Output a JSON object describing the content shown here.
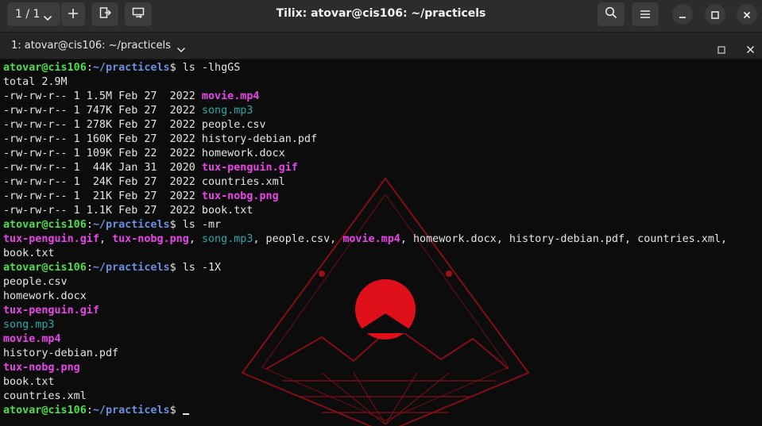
{
  "window": {
    "title": "Tilix: atovar@cis106: ~/practicels",
    "session_counter": "1 / 1"
  },
  "terminal_tab": {
    "label": "1: atovar@cis106: ~/practicels"
  },
  "colors": {
    "prompt_user": "#4edc4b",
    "prompt_path": "#6a8fe0",
    "media_file": "#e845e8",
    "audio_file": "#2aa9a9",
    "art_red": "#e0101a"
  },
  "icons": {
    "session_chevron": "chevron-down-icon",
    "add": "plus-icon",
    "new_terminal": "new-terminal-icon",
    "sync_input": "sync-input-icon",
    "search": "search-icon",
    "menu": "hamburger-menu-icon",
    "minimize": "minimize-icon",
    "maximize": "maximize-icon",
    "close": "close-icon"
  },
  "prompt": {
    "user": "atovar@cis106",
    "sep": ":",
    "path": "~/practicels",
    "dollar": "$"
  },
  "terminal_lines": [
    {
      "type": "prompt",
      "command": "ls -lhgGS"
    },
    {
      "type": "output",
      "segments": [
        {
          "text": "total 2.9M",
          "kind": "plain"
        }
      ]
    },
    {
      "type": "output",
      "segments": [
        {
          "text": "-rw-rw-r-- 1 1.5M Feb 27  2022 ",
          "kind": "plain"
        },
        {
          "text": "movie.mp4",
          "kind": "media"
        }
      ]
    },
    {
      "type": "output",
      "segments": [
        {
          "text": "-rw-rw-r-- 1 747K Feb 27  2022 ",
          "kind": "plain"
        },
        {
          "text": "song.mp3",
          "kind": "audio"
        }
      ]
    },
    {
      "type": "output",
      "segments": [
        {
          "text": "-rw-rw-r-- 1 278K Feb 27  2022 people.csv",
          "kind": "plain"
        }
      ]
    },
    {
      "type": "output",
      "segments": [
        {
          "text": "-rw-rw-r-- 1 160K Feb 27  2022 history-debian.pdf",
          "kind": "plain"
        }
      ]
    },
    {
      "type": "output",
      "segments": [
        {
          "text": "-rw-rw-r-- 1 109K Feb 22  2022 homework.docx",
          "kind": "plain"
        }
      ]
    },
    {
      "type": "output",
      "segments": [
        {
          "text": "-rw-rw-r-- 1  44K Jan 31  2020 ",
          "kind": "plain"
        },
        {
          "text": "tux-penguin.gif",
          "kind": "media"
        }
      ]
    },
    {
      "type": "output",
      "segments": [
        {
          "text": "-rw-rw-r-- 1  24K Feb 27  2022 countries.xml",
          "kind": "plain"
        }
      ]
    },
    {
      "type": "output",
      "segments": [
        {
          "text": "-rw-rw-r-- 1  21K Feb 27  2022 ",
          "kind": "plain"
        },
        {
          "text": "tux-nobg.png",
          "kind": "media"
        }
      ]
    },
    {
      "type": "output",
      "segments": [
        {
          "text": "-rw-rw-r-- 1 1.1K Feb 27  2022 book.txt",
          "kind": "plain"
        }
      ]
    },
    {
      "type": "prompt",
      "command": "ls -mr"
    },
    {
      "type": "output",
      "segments": [
        {
          "text": "tux-penguin.gif",
          "kind": "media"
        },
        {
          "text": ", ",
          "kind": "plain"
        },
        {
          "text": "tux-nobg.png",
          "kind": "media"
        },
        {
          "text": ", ",
          "kind": "plain"
        },
        {
          "text": "song.mp3",
          "kind": "audio"
        },
        {
          "text": ", people.csv, ",
          "kind": "plain"
        },
        {
          "text": "movie.mp4",
          "kind": "media"
        },
        {
          "text": ", homework.docx, history-debian.pdf, countries.xml,",
          "kind": "plain"
        }
      ]
    },
    {
      "type": "output",
      "segments": [
        {
          "text": "book.txt",
          "kind": "plain"
        }
      ]
    },
    {
      "type": "prompt",
      "command": "ls -1X"
    },
    {
      "type": "output",
      "segments": [
        {
          "text": "people.csv",
          "kind": "plain"
        }
      ]
    },
    {
      "type": "output",
      "segments": [
        {
          "text": "homework.docx",
          "kind": "plain"
        }
      ]
    },
    {
      "type": "output",
      "segments": [
        {
          "text": "tux-penguin.gif",
          "kind": "media"
        }
      ]
    },
    {
      "type": "output",
      "segments": [
        {
          "text": "song.mp3",
          "kind": "audio"
        }
      ]
    },
    {
      "type": "output",
      "segments": [
        {
          "text": "movie.mp4",
          "kind": "media"
        }
      ]
    },
    {
      "type": "output",
      "segments": [
        {
          "text": "history-debian.pdf",
          "kind": "plain"
        }
      ]
    },
    {
      "type": "output",
      "segments": [
        {
          "text": "tux-nobg.png",
          "kind": "media"
        }
      ]
    },
    {
      "type": "output",
      "segments": [
        {
          "text": "book.txt",
          "kind": "plain"
        }
      ]
    },
    {
      "type": "output",
      "segments": [
        {
          "text": "countries.xml",
          "kind": "plain"
        }
      ]
    },
    {
      "type": "prompt",
      "command": "",
      "cursor": true
    }
  ]
}
